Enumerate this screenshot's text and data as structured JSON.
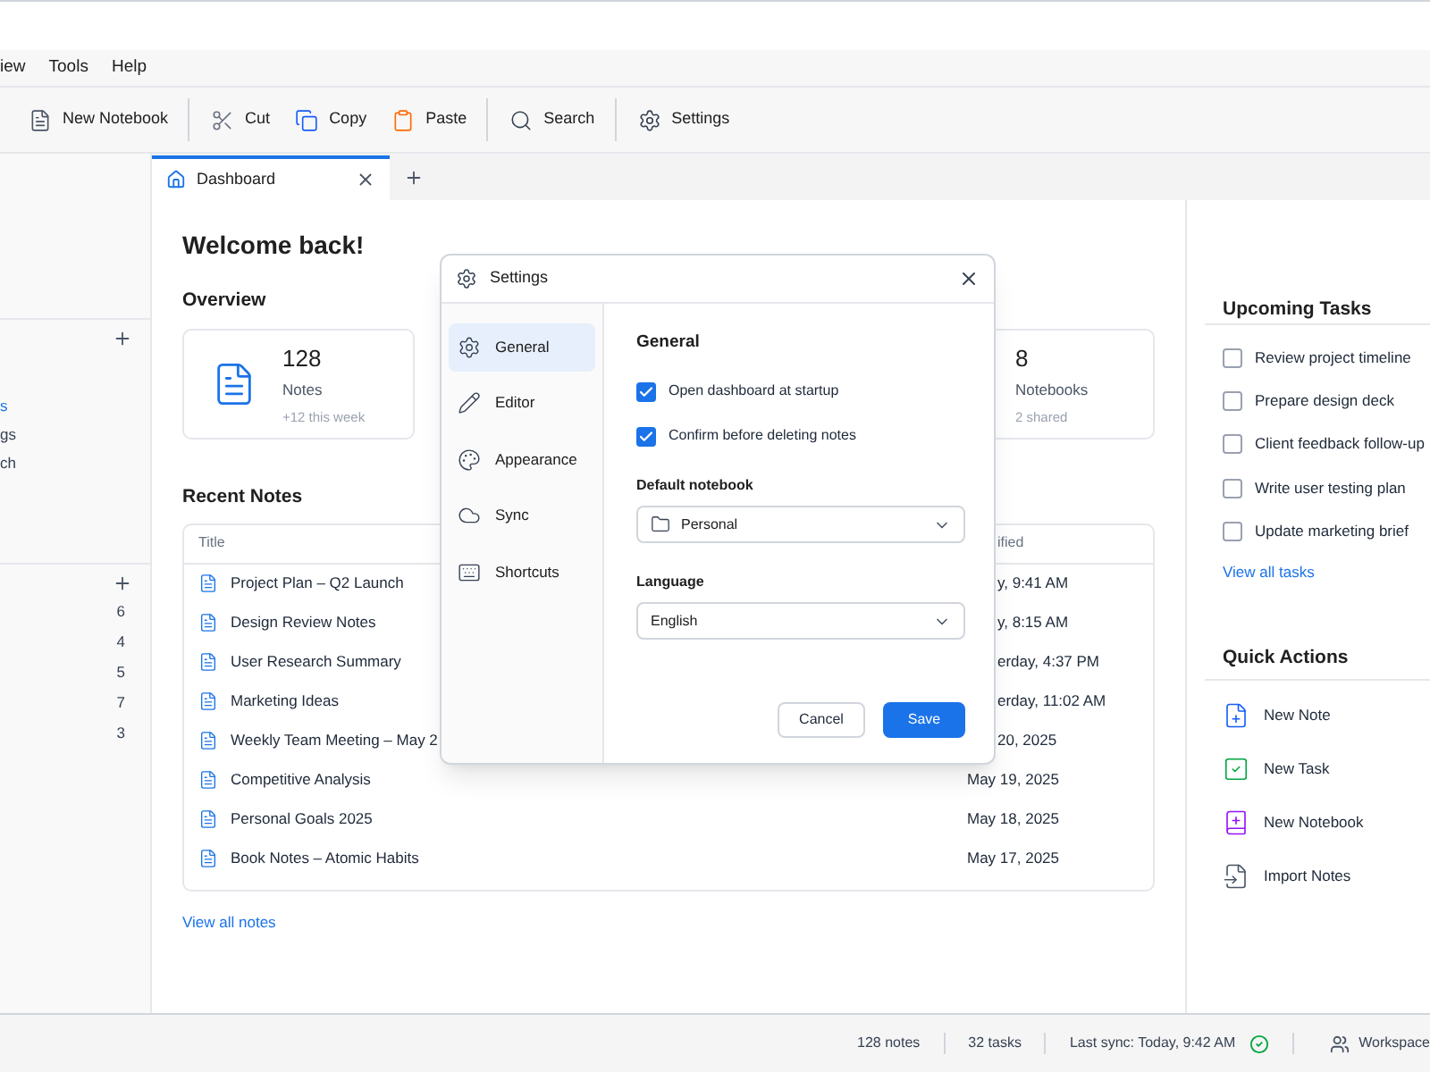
{
  "menu": [
    "iew",
    "Tools",
    "Help"
  ],
  "toolbar": [
    [
      {
        "label": "New Notebook",
        "kind": "notebook"
      }
    ],
    [
      {
        "label": "Cut",
        "kind": "cut"
      },
      {
        "label": "Copy",
        "kind": "copy"
      },
      {
        "label": "Paste",
        "kind": "paste"
      }
    ],
    [
      {
        "label": "Search",
        "kind": "search"
      }
    ],
    [
      {
        "label": "Settings",
        "kind": "settings"
      }
    ]
  ],
  "tabs": [
    {
      "label": "Dashboard",
      "selected": true
    }
  ],
  "sidebar": {
    "sections": [
      {
        "items": [
          {
            "label": "s",
            "selected": true
          },
          {
            "label": "gs",
            "selected": false
          },
          {
            "label": "ch",
            "selected": false
          }
        ]
      },
      {
        "items": [
          {
            "count": "6"
          },
          {
            "count": "4"
          },
          {
            "count": "5"
          },
          {
            "count": "7"
          },
          {
            "count": "3"
          }
        ]
      }
    ]
  },
  "main": {
    "heading": "Welcome back!",
    "overview_title": "Overview",
    "stats": [
      {
        "kind": "notes",
        "value": "128",
        "label": "Notes",
        "sub": "+12 this week"
      },
      {
        "kind": "notebooks",
        "value": "8",
        "label": "Notebooks",
        "sub": "2 shared"
      }
    ],
    "recent_title": "Recent Notes",
    "columns": [
      "Title",
      "ified"
    ],
    "rows": [
      {
        "title": "Project Plan – Q2 Launch",
        "modified": "y, 9:41 AM"
      },
      {
        "title": "Design Review Notes",
        "modified": "y, 8:15 AM"
      },
      {
        "title": "User Research Summary",
        "modified": "erday, 4:37 PM"
      },
      {
        "title": "Marketing Ideas",
        "modified": "erday, 11:02 AM"
      },
      {
        "title": "Weekly Team Meeting – May 2",
        "modified": "20, 2025"
      },
      {
        "title": "Competitive Analysis",
        "modified": "May 19, 2025"
      },
      {
        "title": "Personal Goals 2025",
        "modified": "May 18, 2025"
      },
      {
        "title": "Book Notes – Atomic Habits",
        "modified": "May 17, 2025"
      }
    ],
    "link": "View all notes"
  },
  "tasks": {
    "title": "Upcoming Tasks",
    "items": [
      {
        "label": "Review project timeline",
        "checked": false
      },
      {
        "label": "Prepare design deck",
        "checked": false
      },
      {
        "label": "Client feedback follow-up",
        "checked": false
      },
      {
        "label": "Write user testing plan",
        "checked": false
      },
      {
        "label": "Update marketing brief",
        "checked": false
      }
    ],
    "link": "View all tasks"
  },
  "quick_actions": {
    "title": "Quick Actions",
    "items": [
      {
        "label": "New Note",
        "kind": "note"
      },
      {
        "label": "New Task",
        "kind": "task"
      },
      {
        "label": "New Notebook",
        "kind": "notebook"
      },
      {
        "label": "Import Notes",
        "kind": "import"
      }
    ]
  },
  "dialog": {
    "title": "Settings",
    "nav": [
      {
        "label": "General",
        "kind": "general",
        "selected": true
      },
      {
        "label": "Editor",
        "kind": "editor",
        "selected": false
      },
      {
        "label": "Appearance",
        "kind": "appearance",
        "selected": false
      },
      {
        "label": "Sync",
        "kind": "sync",
        "selected": false
      },
      {
        "label": "Shortcuts",
        "kind": "shortcuts",
        "selected": false
      }
    ],
    "section_title": "General",
    "options": [
      {
        "label": "Open dashboard at startup",
        "checked": true
      },
      {
        "label": "Confirm before deleting notes",
        "checked": true
      }
    ],
    "fields": [
      {
        "label": "Default notebook",
        "value": "Personal",
        "kind": "folder"
      },
      {
        "label": "Language",
        "value": "English",
        "kind": "plain"
      }
    ],
    "buttons": [
      {
        "label": "Cancel",
        "kind": "secondary"
      },
      {
        "label": "Save",
        "kind": "primary"
      }
    ]
  },
  "status_bar": [
    {
      "text": "128 notes",
      "kind": "plain"
    },
    {
      "text": "32 tasks",
      "kind": "plain"
    },
    {
      "text": "Last sync: Today, 9:42 AM",
      "kind": "synced"
    },
    {
      "text": "Workspace",
      "kind": "workspace"
    }
  ]
}
